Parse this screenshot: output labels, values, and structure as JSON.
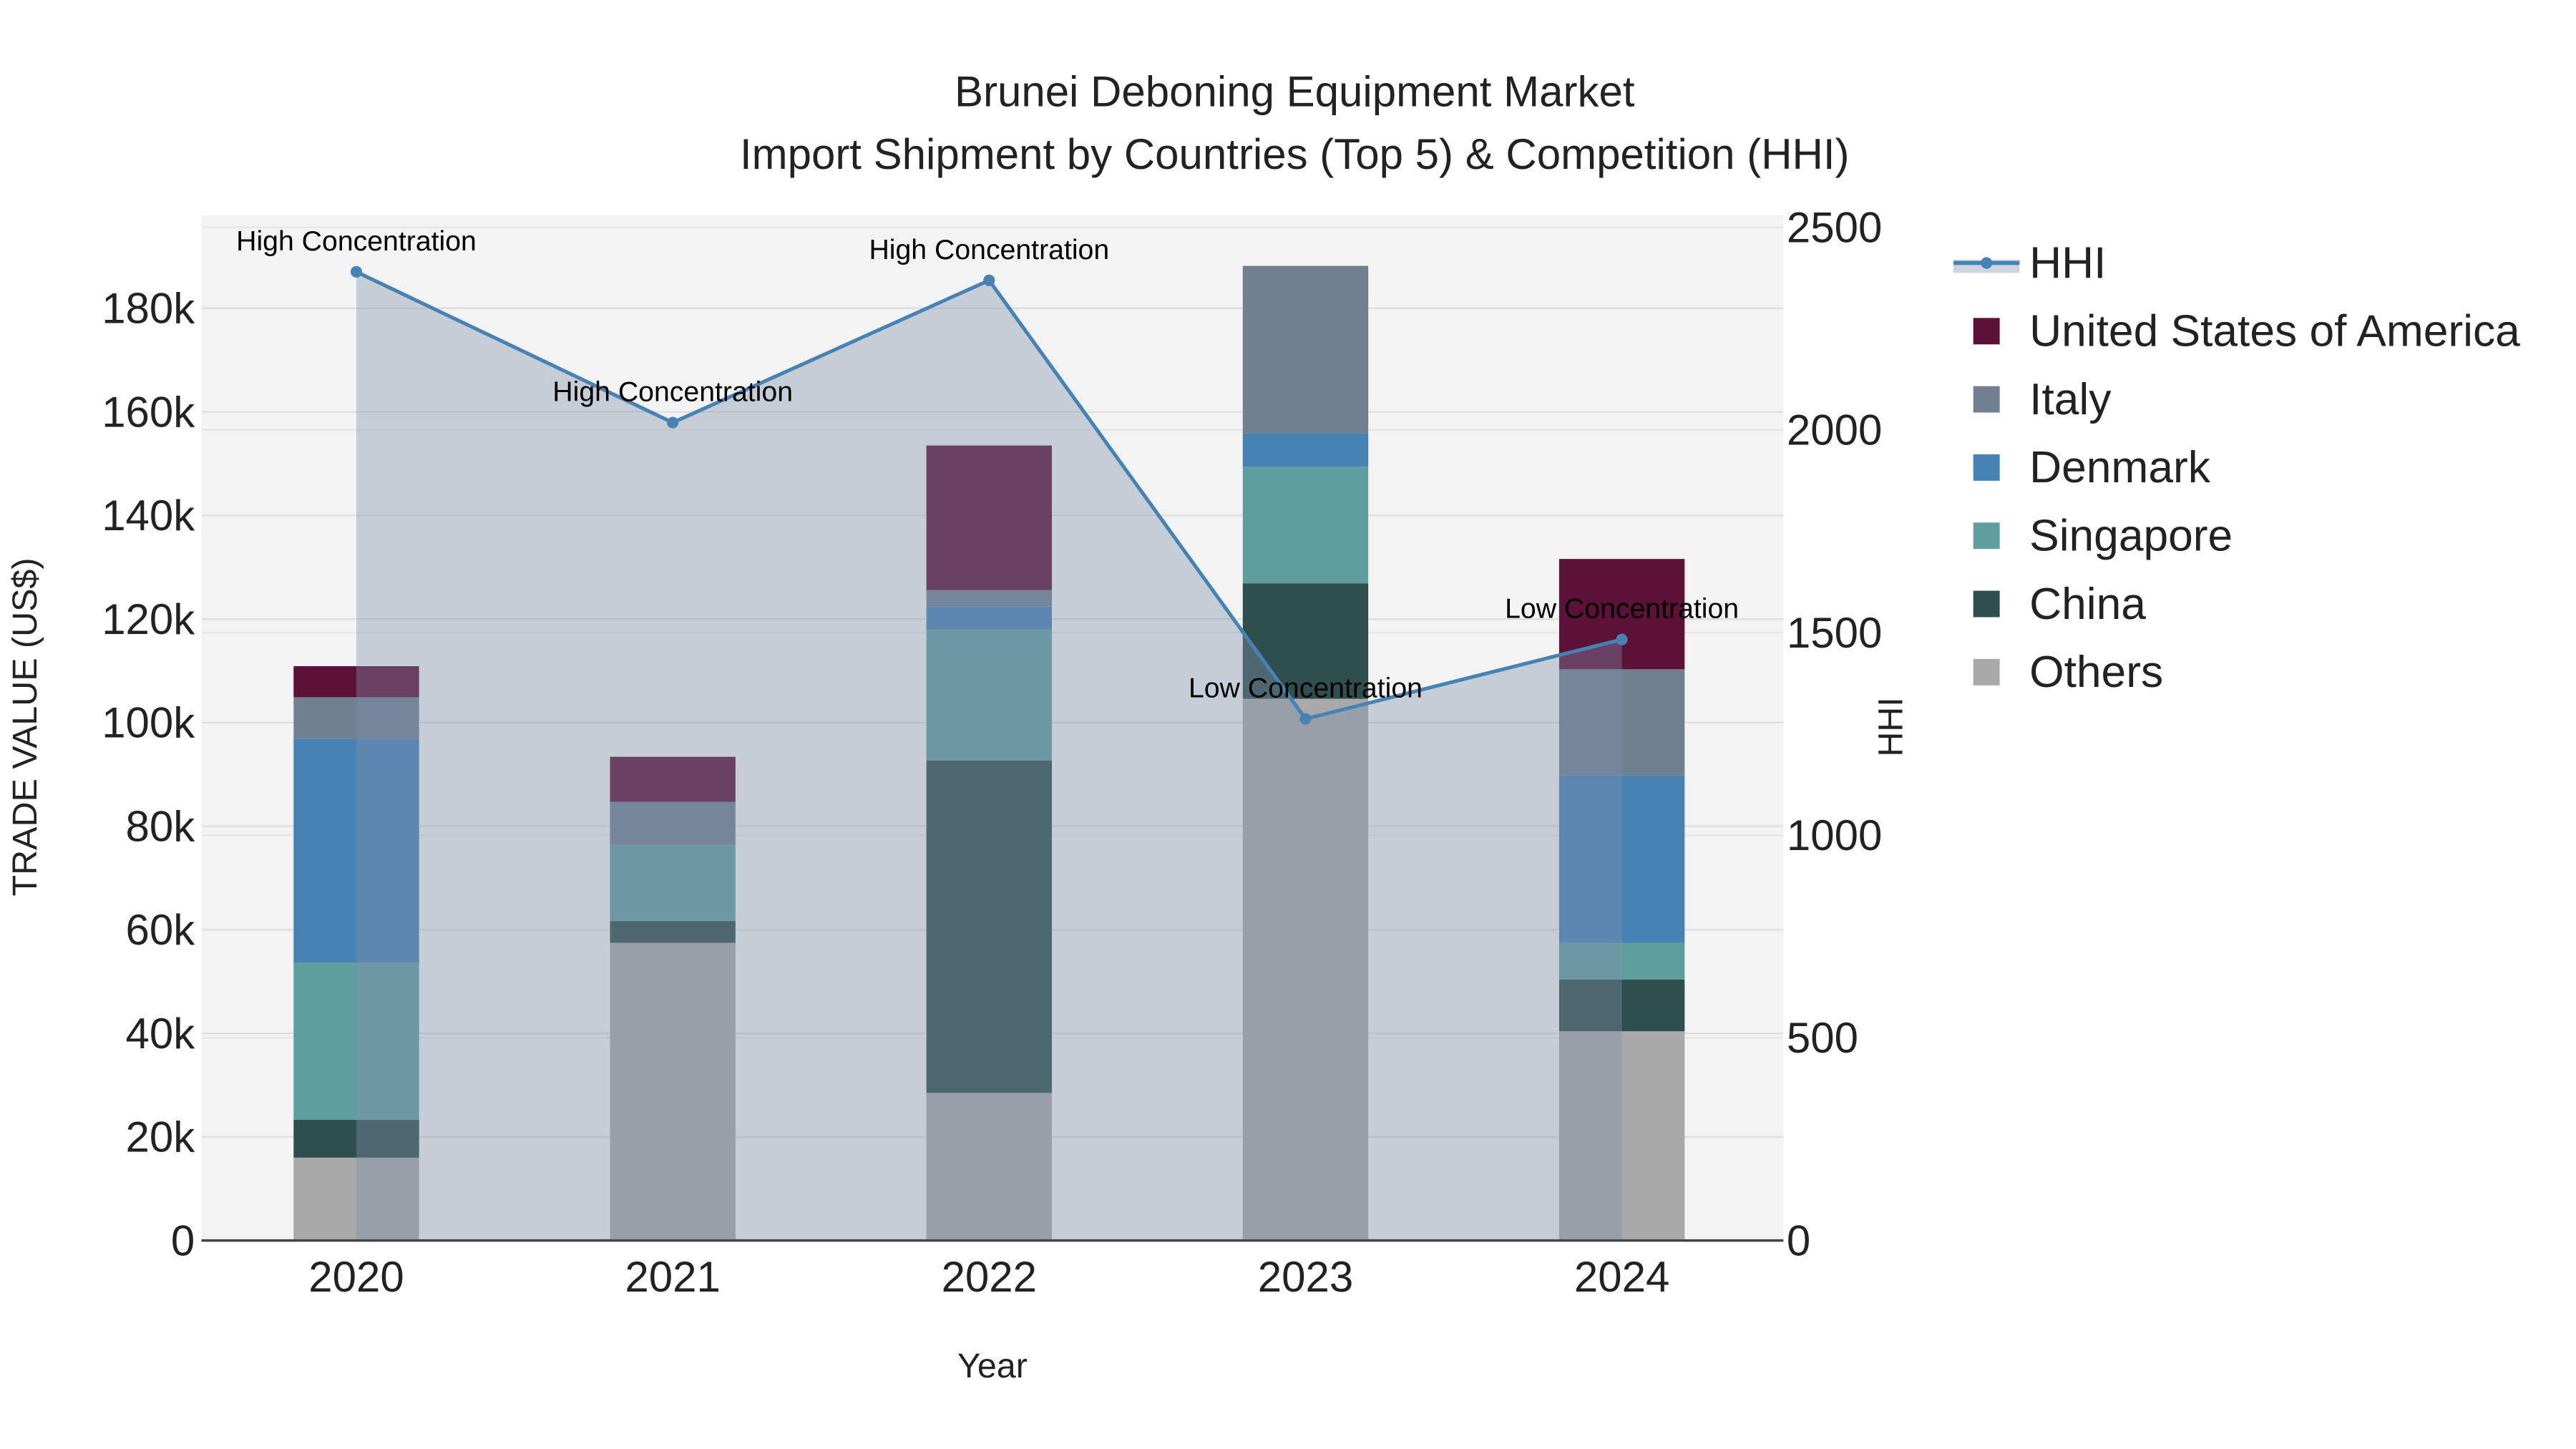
{
  "chart_data": {
    "type": "bar",
    "stacked": true,
    "title": "Brunei Deboning Equipment Market",
    "subtitle": "Import Shipment by Countries (Top 5) & Competition (HHI)",
    "xlabel": "Year",
    "ylabel": "TRADE VALUE (US$)",
    "y2label": "HHI",
    "categories": [
      "2020",
      "2021",
      "2022",
      "2023",
      "2024"
    ],
    "ylim": [
      0,
      198000
    ],
    "yticks": [
      0,
      20000,
      40000,
      60000,
      80000,
      100000,
      120000,
      140000,
      160000,
      180000
    ],
    "ytick_labels": [
      "0",
      "20k",
      "40k",
      "60k",
      "80k",
      "100k",
      "120k",
      "140k",
      "160k",
      "180k"
    ],
    "y2lim": [
      0,
      2530
    ],
    "y2ticks": [
      0,
      500,
      1000,
      1500,
      2000,
      2500
    ],
    "y2tick_labels": [
      "0",
      "500",
      "1000",
      "1500",
      "2000",
      "2500"
    ],
    "grid": true,
    "legend_placement": "right",
    "series": [
      {
        "name": "Others",
        "color": "#a9a9a9",
        "values": [
          16000,
          57500,
          28500,
          104600,
          40400
        ]
      },
      {
        "name": "China",
        "color": "#2f4f4f",
        "values": [
          7300,
          4200,
          64200,
          22300,
          10000
        ]
      },
      {
        "name": "Singapore",
        "color": "#5f9e9e",
        "values": [
          30400,
          14700,
          25300,
          22500,
          7100
        ]
      },
      {
        "name": "Denmark",
        "color": "#4682b4",
        "values": [
          43200,
          0,
          4400,
          6500,
          32300
        ]
      },
      {
        "name": "Italy",
        "color": "#708090",
        "values": [
          8000,
          8300,
          3200,
          32300,
          20500
        ]
      },
      {
        "name": "United States of America",
        "color": "#5c1136",
        "values": [
          6000,
          8700,
          27900,
          0,
          21300
        ]
      }
    ],
    "line": {
      "name": "HHI",
      "color": "#4682b4",
      "values": [
        2390,
        2018,
        2369,
        1287,
        1483
      ],
      "annotations": [
        "High Concentration",
        "High Concentration",
        "High Concentration",
        "Low Concentration",
        "Low Concentration"
      ]
    },
    "legend_order": [
      "HHI",
      "United States of America",
      "Italy",
      "Denmark",
      "Singapore",
      "China",
      "Others"
    ]
  }
}
